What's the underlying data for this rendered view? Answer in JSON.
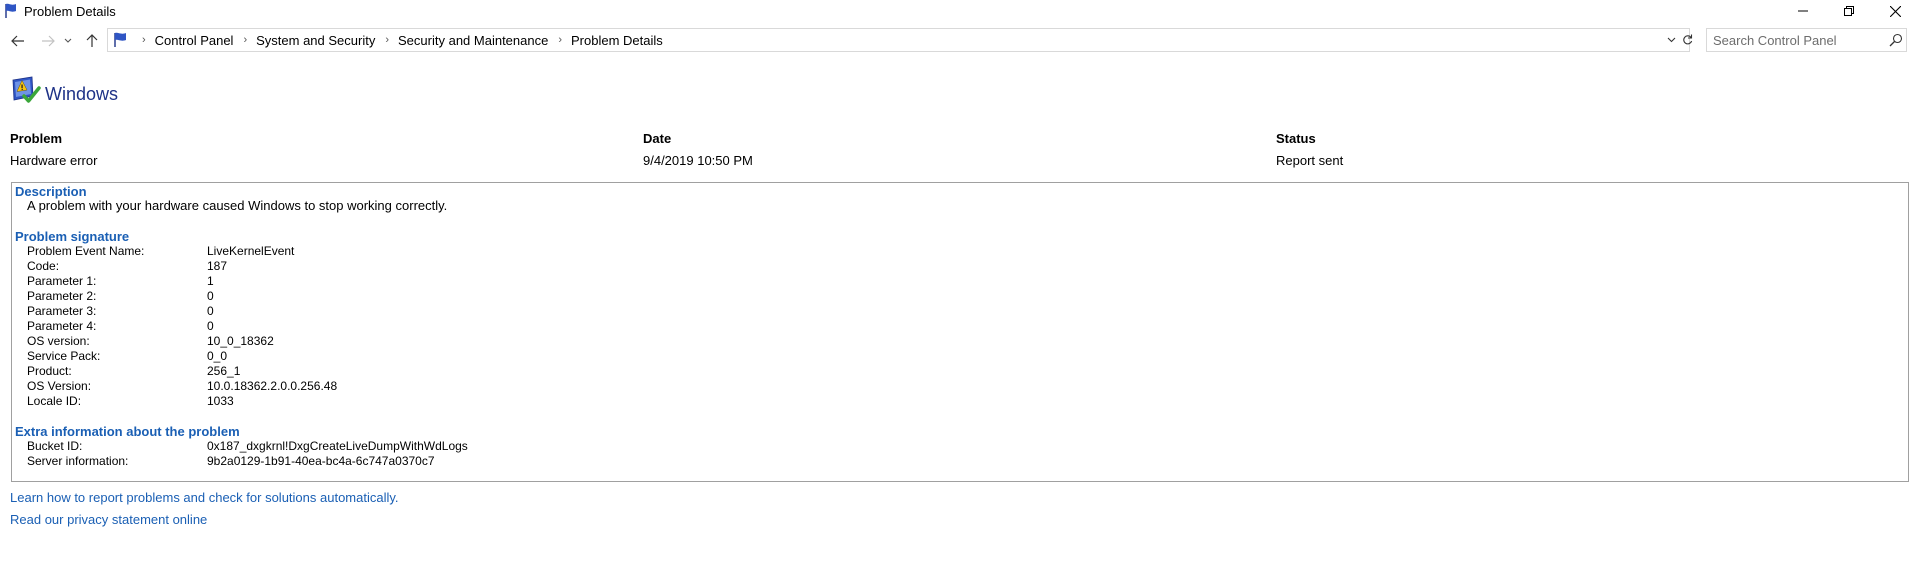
{
  "window": {
    "title": "Problem Details"
  },
  "nav": {
    "breadcrumbs": [
      "Control Panel",
      "System and Security",
      "Security and Maintenance",
      "Problem Details"
    ],
    "search_placeholder": "Search Control Panel"
  },
  "header": {
    "title": "Windows"
  },
  "summary": {
    "headers": [
      "Problem",
      "Date",
      "Status"
    ],
    "values": [
      "Hardware error",
      "9/4/2019 10:50 PM",
      "Report sent"
    ]
  },
  "description": {
    "title": "Description",
    "text": "A problem with your hardware caused Windows to stop working correctly."
  },
  "signature": {
    "title": "Problem signature",
    "rows": [
      {
        "key": "Problem Event Name:",
        "value": "LiveKernelEvent"
      },
      {
        "key": "Code:",
        "value": "187"
      },
      {
        "key": "Parameter 1:",
        "value": "1"
      },
      {
        "key": "Parameter 2:",
        "value": "0"
      },
      {
        "key": "Parameter 3:",
        "value": "0"
      },
      {
        "key": "Parameter 4:",
        "value": "0"
      },
      {
        "key": "OS version:",
        "value": "10_0_18362"
      },
      {
        "key": "Service Pack:",
        "value": "0_0"
      },
      {
        "key": "Product:",
        "value": "256_1"
      },
      {
        "key": "OS Version:",
        "value": "10.0.18362.2.0.0.256.48"
      },
      {
        "key": "Locale ID:",
        "value": "1033"
      }
    ]
  },
  "extra": {
    "title": "Extra information about the problem",
    "rows": [
      {
        "key": "Bucket ID:",
        "value": "0x187_dxgkrnl!DxgCreateLiveDumpWithWdLogs"
      },
      {
        "key": "Server information:",
        "value": "9b2a0129-1b91-40ea-bc4a-6c747a0370c7"
      }
    ]
  },
  "links": {
    "learn": "Learn how to report problems and check for solutions automatically.",
    "privacy": "Read our privacy statement online"
  },
  "colors": {
    "link": "#1a5fb4",
    "header_title": "#1e3287"
  }
}
